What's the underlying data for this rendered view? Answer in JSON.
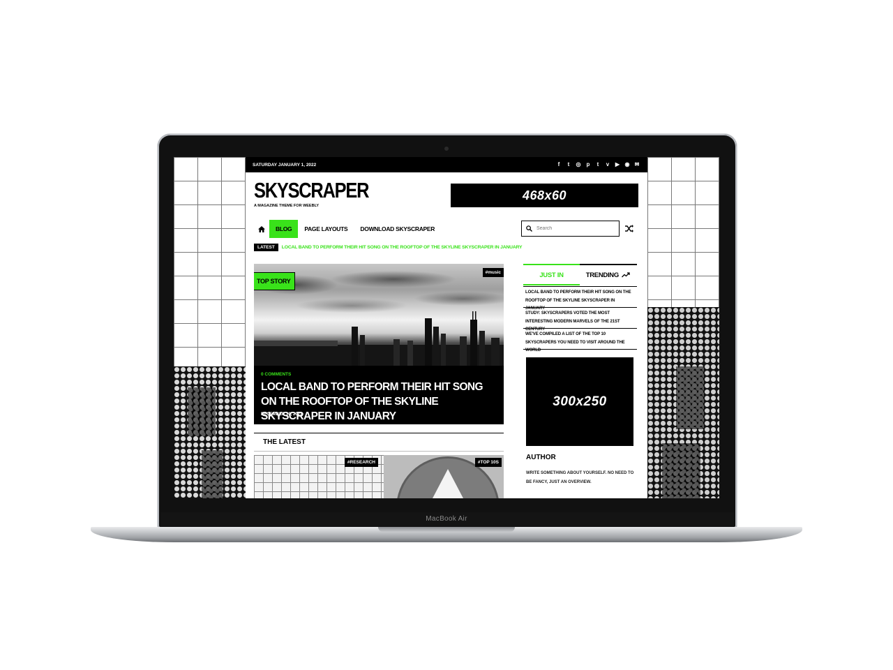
{
  "device": {
    "brand_label": "MacBook Air"
  },
  "colors": {
    "accent": "#39e21a",
    "dark": "#000000"
  },
  "topbar": {
    "date": "Saturday January 1, 2022",
    "social_icons": [
      {
        "name": "facebook-icon",
        "glyph": "f"
      },
      {
        "name": "twitter-icon",
        "glyph": "t"
      },
      {
        "name": "instagram-icon",
        "glyph": "◎"
      },
      {
        "name": "pinterest-icon",
        "glyph": "p"
      },
      {
        "name": "tumblr-icon",
        "glyph": "t"
      },
      {
        "name": "vimeo-icon",
        "glyph": "v"
      },
      {
        "name": "youtube-icon",
        "glyph": "▶"
      },
      {
        "name": "dribbble-icon",
        "glyph": "◉"
      },
      {
        "name": "email-icon",
        "glyph": "✉"
      }
    ]
  },
  "header": {
    "logo": "SKYSCRAPER",
    "tagline": "A Magazine Theme for Weebly",
    "ad_banner": "468x60"
  },
  "nav": {
    "items": [
      {
        "label": "Blog"
      },
      {
        "label": "Page Layouts"
      },
      {
        "label": "Download Skyscraper"
      }
    ]
  },
  "search": {
    "placeholder": "Search"
  },
  "ticker": {
    "label": "Latest",
    "text": "Local band to perform their hit song on the rooftop of the Skyline Skyscraper in January"
  },
  "hero": {
    "badge": "Top Story",
    "tag": "#music",
    "comments": "0 Comments",
    "title": "Local band to perform their hit song on the rooftop of the Skyline Skyscraper in January",
    "date": "December 30, 2021"
  },
  "latest": {
    "heading": "The Latest",
    "cards": [
      {
        "tag": "#research"
      },
      {
        "tag": "#top 10s"
      }
    ]
  },
  "sidebar": {
    "tabs": [
      {
        "label": "Just In"
      },
      {
        "label": "Trending"
      }
    ],
    "items": [
      "Local band to perform their hit song on the rooftop of the Skyline Skyscraper in January",
      "Study: Skyscrapers voted the most interesting modern marvels of the 21st century",
      "We've compiled a list of the top 10 skyscrapers you need to visit around the world"
    ],
    "ad_box": "300x250",
    "author_heading": "Author",
    "author_text": "Write something about yourself. No need to be fancy, just an overview."
  }
}
